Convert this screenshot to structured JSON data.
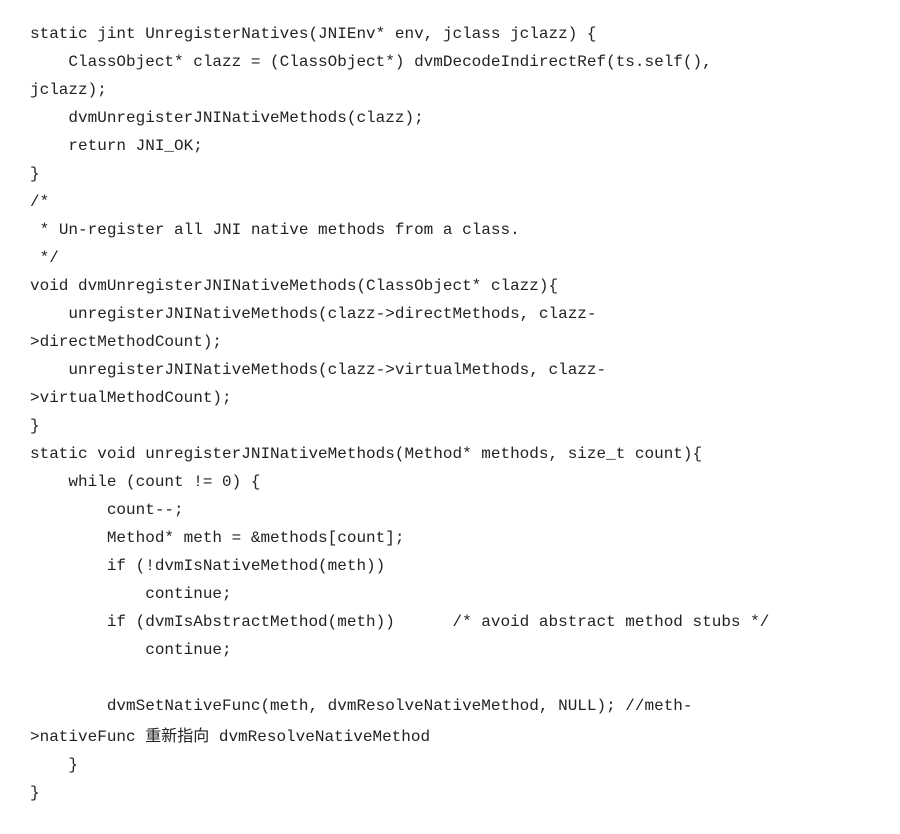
{
  "code": {
    "lines": [
      "static jint UnregisterNatives(JNIEnv* env, jclass jclazz) {",
      "    ClassObject* clazz = (ClassObject*) dvmDecodeIndirectRef(ts.self(),",
      "jclazz);",
      "    dvmUnregisterJNINativeMethods(clazz);",
      "    return JNI_OK;",
      "}",
      "/*",
      " * Un-register all JNI native methods from a class.",
      " */",
      "void dvmUnregisterJNINativeMethods(ClassObject* clazz){",
      "    unregisterJNINativeMethods(clazz->directMethods, clazz-",
      ">directMethodCount);",
      "    unregisterJNINativeMethods(clazz->virtualMethods, clazz-",
      ">virtualMethodCount);",
      "}",
      "static void unregisterJNINativeMethods(Method* methods, size_t count){",
      "    while (count != 0) {",
      "        count--;",
      "        Method* meth = &methods[count];",
      "        if (!dvmIsNativeMethod(meth))",
      "            continue;",
      "        if (dvmIsAbstractMethod(meth))      /* avoid abstract method stubs */",
      "            continue;",
      "",
      "        dvmSetNativeFunc(meth, dvmResolveNativeMethod, NULL); //meth-",
      ">nativeFunc 重新指向 dvmResolveNativeMethod",
      "    }",
      "}"
    ]
  }
}
